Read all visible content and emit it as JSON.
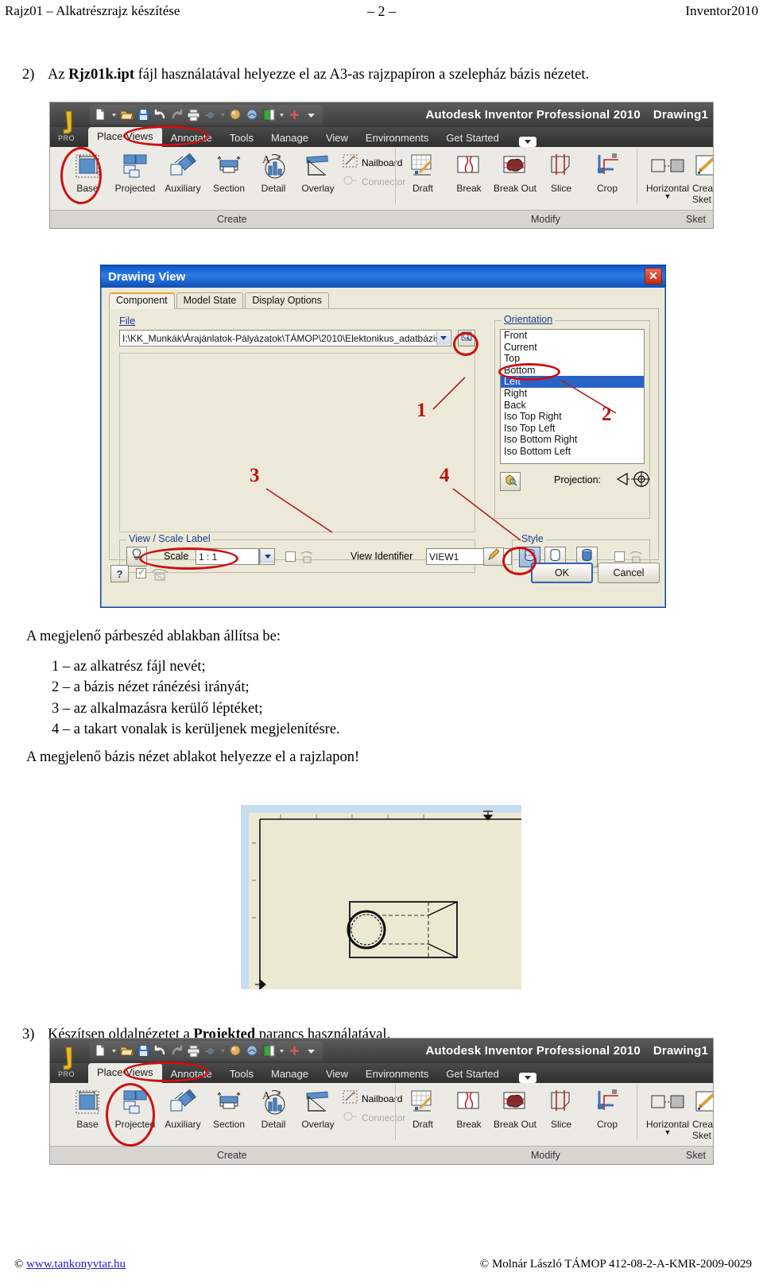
{
  "running_head": {
    "left": "Rajz01 – Alkatrészrajz készítése",
    "center": "– 2 –",
    "right": "Inventor2010"
  },
  "steps": {
    "step2": {
      "number": "2)",
      "pre": "Az ",
      "bold": "Rjz01k.ipt",
      "post": " fájl használatával helyezze el az A3-as rajzpapíron a szelepház bázis nézetet."
    },
    "step3": {
      "number": "3)",
      "pre": "Készítsen oldalnézetet a ",
      "bold": "Projekted",
      "post": " parancs használatával."
    }
  },
  "body": {
    "intro": "A megjelenő párbeszéd ablakban állítsa be:",
    "list": [
      "1 – az alkatrész fájl nevét;",
      "2 – a bázis nézet ránézési irányát;",
      "3 – az alkalmazásra kerülő léptéket;",
      "4 – a takart vonalak is kerüljenek megjelenítésre."
    ],
    "after_list": "A megjelenő bázis nézet ablakot helyezze el a rajzlapon!"
  },
  "ribbon": {
    "app_title": "Autodesk Inventor Professional 2010",
    "document_title": "Drawing1",
    "app_logo_label": "PRO",
    "quick_access_icons": [
      "new-file-icon",
      "open-folder-icon",
      "save-icon",
      "undo-icon",
      "redo-icon",
      "print-icon",
      "update-icon",
      "select-icon",
      "material-icon",
      "appearance-icon",
      "add-icon",
      "qat-dropdown-icon"
    ],
    "tabs": [
      "Place Views",
      "Annotate",
      "Tools",
      "Manage",
      "View",
      "Environments",
      "Get Started"
    ],
    "active_tab": "Place Views",
    "create_items": [
      {
        "label": "Base",
        "icon": "base-view-icon"
      },
      {
        "label": "Projected",
        "icon": "projected-view-icon"
      },
      {
        "label": "Auxiliary",
        "icon": "auxiliary-view-icon"
      },
      {
        "label": "Section",
        "icon": "section-view-icon"
      },
      {
        "label": "Detail",
        "icon": "detail-view-icon"
      },
      {
        "label": "Overlay",
        "icon": "overlay-view-icon"
      }
    ],
    "create_small_items": [
      {
        "label": "Nailboard",
        "icon": "nailboard-icon",
        "enabled": true
      },
      {
        "label": "Connector",
        "icon": "connector-icon",
        "enabled": false
      }
    ],
    "modify_items": [
      {
        "label": "Draft",
        "icon": "draft-icon"
      },
      {
        "label": "Break",
        "icon": "break-icon"
      },
      {
        "label": "Break Out",
        "icon": "break-out-icon"
      },
      {
        "label": "Slice",
        "icon": "slice-icon"
      },
      {
        "label": "Crop",
        "icon": "crop-icon"
      }
    ],
    "sketch_items": [
      {
        "label": "Horizontal",
        "icon": "horizontal-icon",
        "has_dropdown": true
      },
      {
        "label": "Create Sketch",
        "line1": "Crea",
        "line2": "Sket",
        "icon": "create-sketch-icon"
      }
    ],
    "panel_labels": {
      "create": "Create",
      "modify": "Modify",
      "sketch": "Sket"
    },
    "highlight_top": "Base",
    "highlight_bottom": "Projected"
  },
  "dialog": {
    "title": "Drawing View",
    "close_label": "✕",
    "tabs": [
      "Component",
      "Model State",
      "Display Options"
    ],
    "active_tab": "Component",
    "file_label": "File",
    "file_value": "I:\\KK_Munkák\\Árajánlatok-Pályázatok\\TÁMOP\\2010\\Elektonikus_adatbázis\\Munka\\",
    "browse_icon": "browse-file-icon",
    "orientation_label": "Orientation",
    "orientation_items": [
      "Front",
      "Current",
      "Top",
      "Bottom",
      "Left",
      "Right",
      "Back",
      "Iso Top Right",
      "Iso Top Left",
      "Iso Bottom Right",
      "Iso Bottom Left"
    ],
    "orientation_selected": "Left",
    "change_view_orientation_icon": "change-view-orientation-icon",
    "projection_label": "Projection:",
    "projection_icon": "first-angle-projection-icon",
    "view_scale_group": "View / Scale Label",
    "toggle_visibility_icon": "lightbulb-icon",
    "scale_label": "Scale",
    "scale_value": "1 : 1",
    "scale_checkbox_checked": false,
    "scale_style_icon": "scale-style-icon",
    "view_identifier_label": "View Identifier",
    "view_identifier_value": "VIEW1",
    "edit_identifier_icon": "pencil-edit-icon",
    "style_group": "Style",
    "style_buttons": [
      {
        "name": "hidden-line-style",
        "selected": true
      },
      {
        "name": "hidden-line-removed-style",
        "selected": false
      },
      {
        "name": "shaded-style",
        "selected": false
      }
    ],
    "style_checkbox_checked": false,
    "style_from_base_icon": "style-from-base-icon",
    "help_icon": "help-question-icon",
    "raster_checkbox_checked": true,
    "raster_icon": "raster-view-icon",
    "ok_label": "OK",
    "cancel_label": "Cancel",
    "callouts": [
      "1",
      "2",
      "3",
      "4"
    ]
  },
  "colors": {
    "accent_red": "#bb1111",
    "dialog_title_blue": "#0d55c4",
    "selection_blue": "#2a63c8",
    "dialog_face": "#ece9d8",
    "ribbon_face": "#eceae4",
    "link_blue": "#1c1cc8",
    "sheet_paper": "#ebe9d2"
  },
  "footer": {
    "copyright_left_symbol": "©",
    "left_link": "www.tankonyvtar.hu",
    "right": "© Molnár László TÁMOP 412-08-2-A-KMR-2009-0029"
  }
}
